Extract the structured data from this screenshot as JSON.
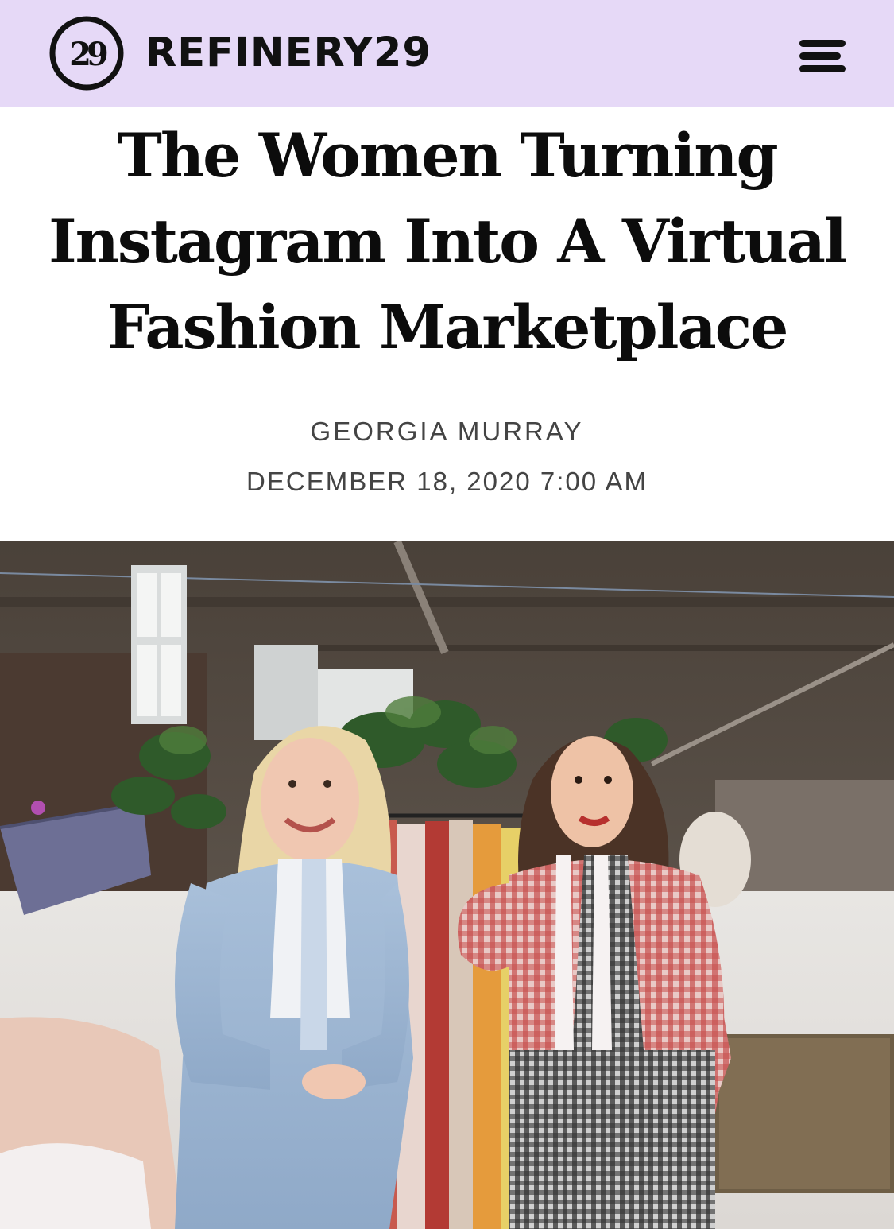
{
  "header": {
    "logo_icon": "refinery29-roundel-logo",
    "wordmark": "REFINERY29",
    "menu_icon": "hamburger-menu-icon",
    "background": "#e6d9f7"
  },
  "article": {
    "title": "The Women Turning Instagram Into A Virtual Fashion Marketplace",
    "author": "GEORGIA MURRAY",
    "timestamp": "DECEMBER 18, 2020 7:00 AM"
  },
  "hero_image": {
    "description_icon": "photo-two-women-in-studio"
  }
}
